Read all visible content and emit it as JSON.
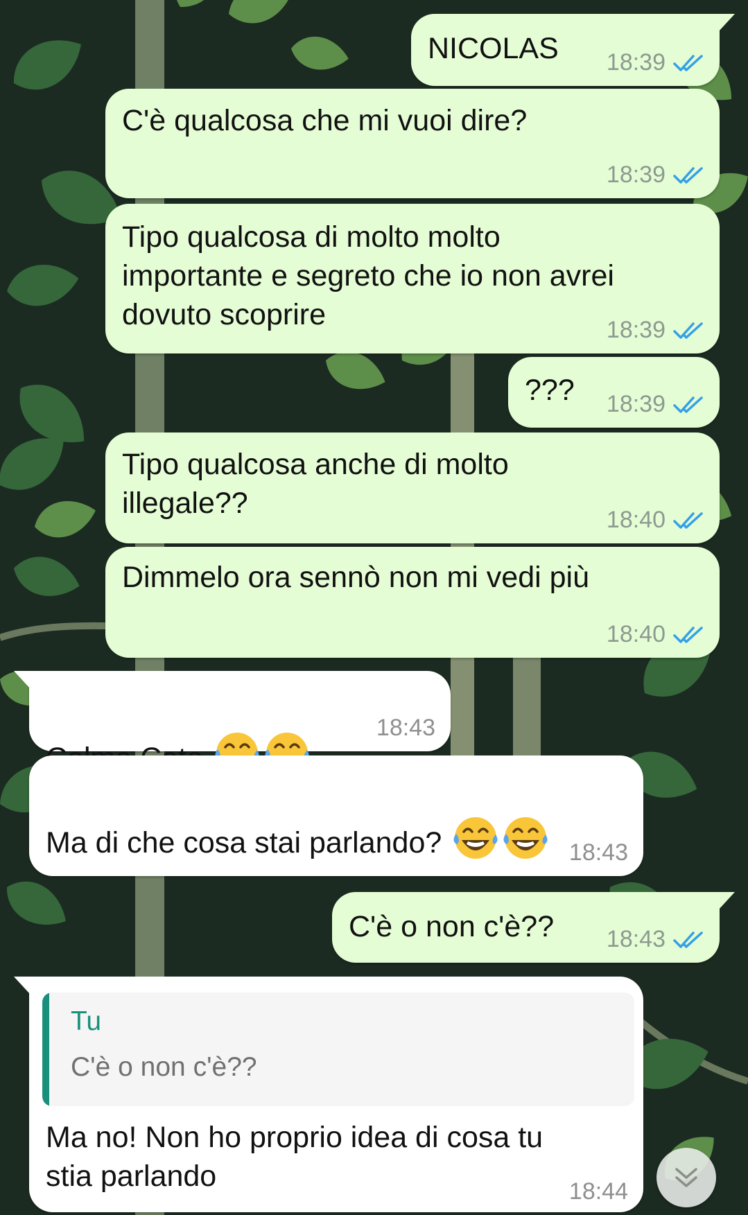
{
  "colors": {
    "outgoing_bubble": "#e5fdd5",
    "incoming_bubble": "#ffffff",
    "read_ticks": "#34a0e6",
    "quote_accent": "#1a907c",
    "timestamp": "#8c9a90"
  },
  "messages": [
    {
      "direction": "outgoing",
      "text": "NICOLAS",
      "time": "18:39",
      "status": "read-double-check-icon"
    },
    {
      "direction": "outgoing",
      "text": "C'è qualcosa che mi vuoi dire?",
      "time": "18:39",
      "status": "read-double-check-icon"
    },
    {
      "direction": "outgoing",
      "text": "Tipo qualcosa di molto molto\nimportante e segreto che io non avrei\ndovuto scoprire",
      "time": "18:39",
      "status": "read-double-check-icon"
    },
    {
      "direction": "outgoing",
      "text": "???",
      "time": "18:39",
      "status": "read-double-check-icon"
    },
    {
      "direction": "outgoing",
      "text": "Tipo qualcosa anche di molto\nillegale??",
      "time": "18:40",
      "status": "read-double-check-icon"
    },
    {
      "direction": "outgoing",
      "text": "Dimmelo ora sennò non mi vedi più",
      "time": "18:40",
      "status": "read-double-check-icon"
    },
    {
      "direction": "incoming",
      "text": "Calma Cate ",
      "emoji": [
        "laughing-tears-emoji",
        "laughing-tears-emoji"
      ],
      "time": "18:43"
    },
    {
      "direction": "incoming",
      "text": "Ma di che cosa stai parlando? ",
      "emoji": [
        "laughing-tears-emoji",
        "laughing-tears-emoji"
      ],
      "time": "18:43"
    },
    {
      "direction": "outgoing",
      "text": "C'è o non c'è??",
      "time": "18:43",
      "status": "read-double-check-icon"
    },
    {
      "direction": "incoming",
      "quote": {
        "author": "Tu",
        "text": "C'è o non c'è??"
      },
      "text": "Ma no! Non ho proprio idea di cosa tu\nstia parlando",
      "time": "18:44"
    }
  ],
  "scroll_button_icon": "double-chevron-down-icon"
}
